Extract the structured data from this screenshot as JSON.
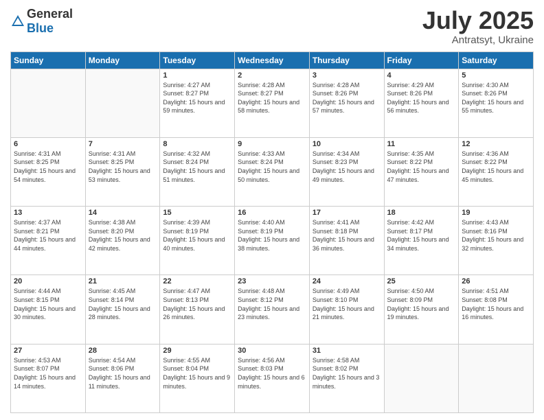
{
  "header": {
    "logo_general": "General",
    "logo_blue": "Blue",
    "month": "July 2025",
    "location": "Antratsyt, Ukraine"
  },
  "days_of_week": [
    "Sunday",
    "Monday",
    "Tuesday",
    "Wednesday",
    "Thursday",
    "Friday",
    "Saturday"
  ],
  "weeks": [
    [
      {
        "day": "",
        "info": ""
      },
      {
        "day": "",
        "info": ""
      },
      {
        "day": "1",
        "sunrise": "4:27 AM",
        "sunset": "8:27 PM",
        "daylight": "15 hours and 59 minutes."
      },
      {
        "day": "2",
        "sunrise": "4:28 AM",
        "sunset": "8:27 PM",
        "daylight": "15 hours and 58 minutes."
      },
      {
        "day": "3",
        "sunrise": "4:28 AM",
        "sunset": "8:26 PM",
        "daylight": "15 hours and 57 minutes."
      },
      {
        "day": "4",
        "sunrise": "4:29 AM",
        "sunset": "8:26 PM",
        "daylight": "15 hours and 56 minutes."
      },
      {
        "day": "5",
        "sunrise": "4:30 AM",
        "sunset": "8:26 PM",
        "daylight": "15 hours and 55 minutes."
      }
    ],
    [
      {
        "day": "6",
        "sunrise": "4:31 AM",
        "sunset": "8:25 PM",
        "daylight": "15 hours and 54 minutes."
      },
      {
        "day": "7",
        "sunrise": "4:31 AM",
        "sunset": "8:25 PM",
        "daylight": "15 hours and 53 minutes."
      },
      {
        "day": "8",
        "sunrise": "4:32 AM",
        "sunset": "8:24 PM",
        "daylight": "15 hours and 51 minutes."
      },
      {
        "day": "9",
        "sunrise": "4:33 AM",
        "sunset": "8:24 PM",
        "daylight": "15 hours and 50 minutes."
      },
      {
        "day": "10",
        "sunrise": "4:34 AM",
        "sunset": "8:23 PM",
        "daylight": "15 hours and 49 minutes."
      },
      {
        "day": "11",
        "sunrise": "4:35 AM",
        "sunset": "8:22 PM",
        "daylight": "15 hours and 47 minutes."
      },
      {
        "day": "12",
        "sunrise": "4:36 AM",
        "sunset": "8:22 PM",
        "daylight": "15 hours and 45 minutes."
      }
    ],
    [
      {
        "day": "13",
        "sunrise": "4:37 AM",
        "sunset": "8:21 PM",
        "daylight": "15 hours and 44 minutes."
      },
      {
        "day": "14",
        "sunrise": "4:38 AM",
        "sunset": "8:20 PM",
        "daylight": "15 hours and 42 minutes."
      },
      {
        "day": "15",
        "sunrise": "4:39 AM",
        "sunset": "8:19 PM",
        "daylight": "15 hours and 40 minutes."
      },
      {
        "day": "16",
        "sunrise": "4:40 AM",
        "sunset": "8:19 PM",
        "daylight": "15 hours and 38 minutes."
      },
      {
        "day": "17",
        "sunrise": "4:41 AM",
        "sunset": "8:18 PM",
        "daylight": "15 hours and 36 minutes."
      },
      {
        "day": "18",
        "sunrise": "4:42 AM",
        "sunset": "8:17 PM",
        "daylight": "15 hours and 34 minutes."
      },
      {
        "day": "19",
        "sunrise": "4:43 AM",
        "sunset": "8:16 PM",
        "daylight": "15 hours and 32 minutes."
      }
    ],
    [
      {
        "day": "20",
        "sunrise": "4:44 AM",
        "sunset": "8:15 PM",
        "daylight": "15 hours and 30 minutes."
      },
      {
        "day": "21",
        "sunrise": "4:45 AM",
        "sunset": "8:14 PM",
        "daylight": "15 hours and 28 minutes."
      },
      {
        "day": "22",
        "sunrise": "4:47 AM",
        "sunset": "8:13 PM",
        "daylight": "15 hours and 26 minutes."
      },
      {
        "day": "23",
        "sunrise": "4:48 AM",
        "sunset": "8:12 PM",
        "daylight": "15 hours and 23 minutes."
      },
      {
        "day": "24",
        "sunrise": "4:49 AM",
        "sunset": "8:10 PM",
        "daylight": "15 hours and 21 minutes."
      },
      {
        "day": "25",
        "sunrise": "4:50 AM",
        "sunset": "8:09 PM",
        "daylight": "15 hours and 19 minutes."
      },
      {
        "day": "26",
        "sunrise": "4:51 AM",
        "sunset": "8:08 PM",
        "daylight": "15 hours and 16 minutes."
      }
    ],
    [
      {
        "day": "27",
        "sunrise": "4:53 AM",
        "sunset": "8:07 PM",
        "daylight": "15 hours and 14 minutes."
      },
      {
        "day": "28",
        "sunrise": "4:54 AM",
        "sunset": "8:06 PM",
        "daylight": "15 hours and 11 minutes."
      },
      {
        "day": "29",
        "sunrise": "4:55 AM",
        "sunset": "8:04 PM",
        "daylight": "15 hours and 9 minutes."
      },
      {
        "day": "30",
        "sunrise": "4:56 AM",
        "sunset": "8:03 PM",
        "daylight": "15 hours and 6 minutes."
      },
      {
        "day": "31",
        "sunrise": "4:58 AM",
        "sunset": "8:02 PM",
        "daylight": "15 hours and 3 minutes."
      },
      {
        "day": "",
        "info": ""
      },
      {
        "day": "",
        "info": ""
      }
    ]
  ]
}
